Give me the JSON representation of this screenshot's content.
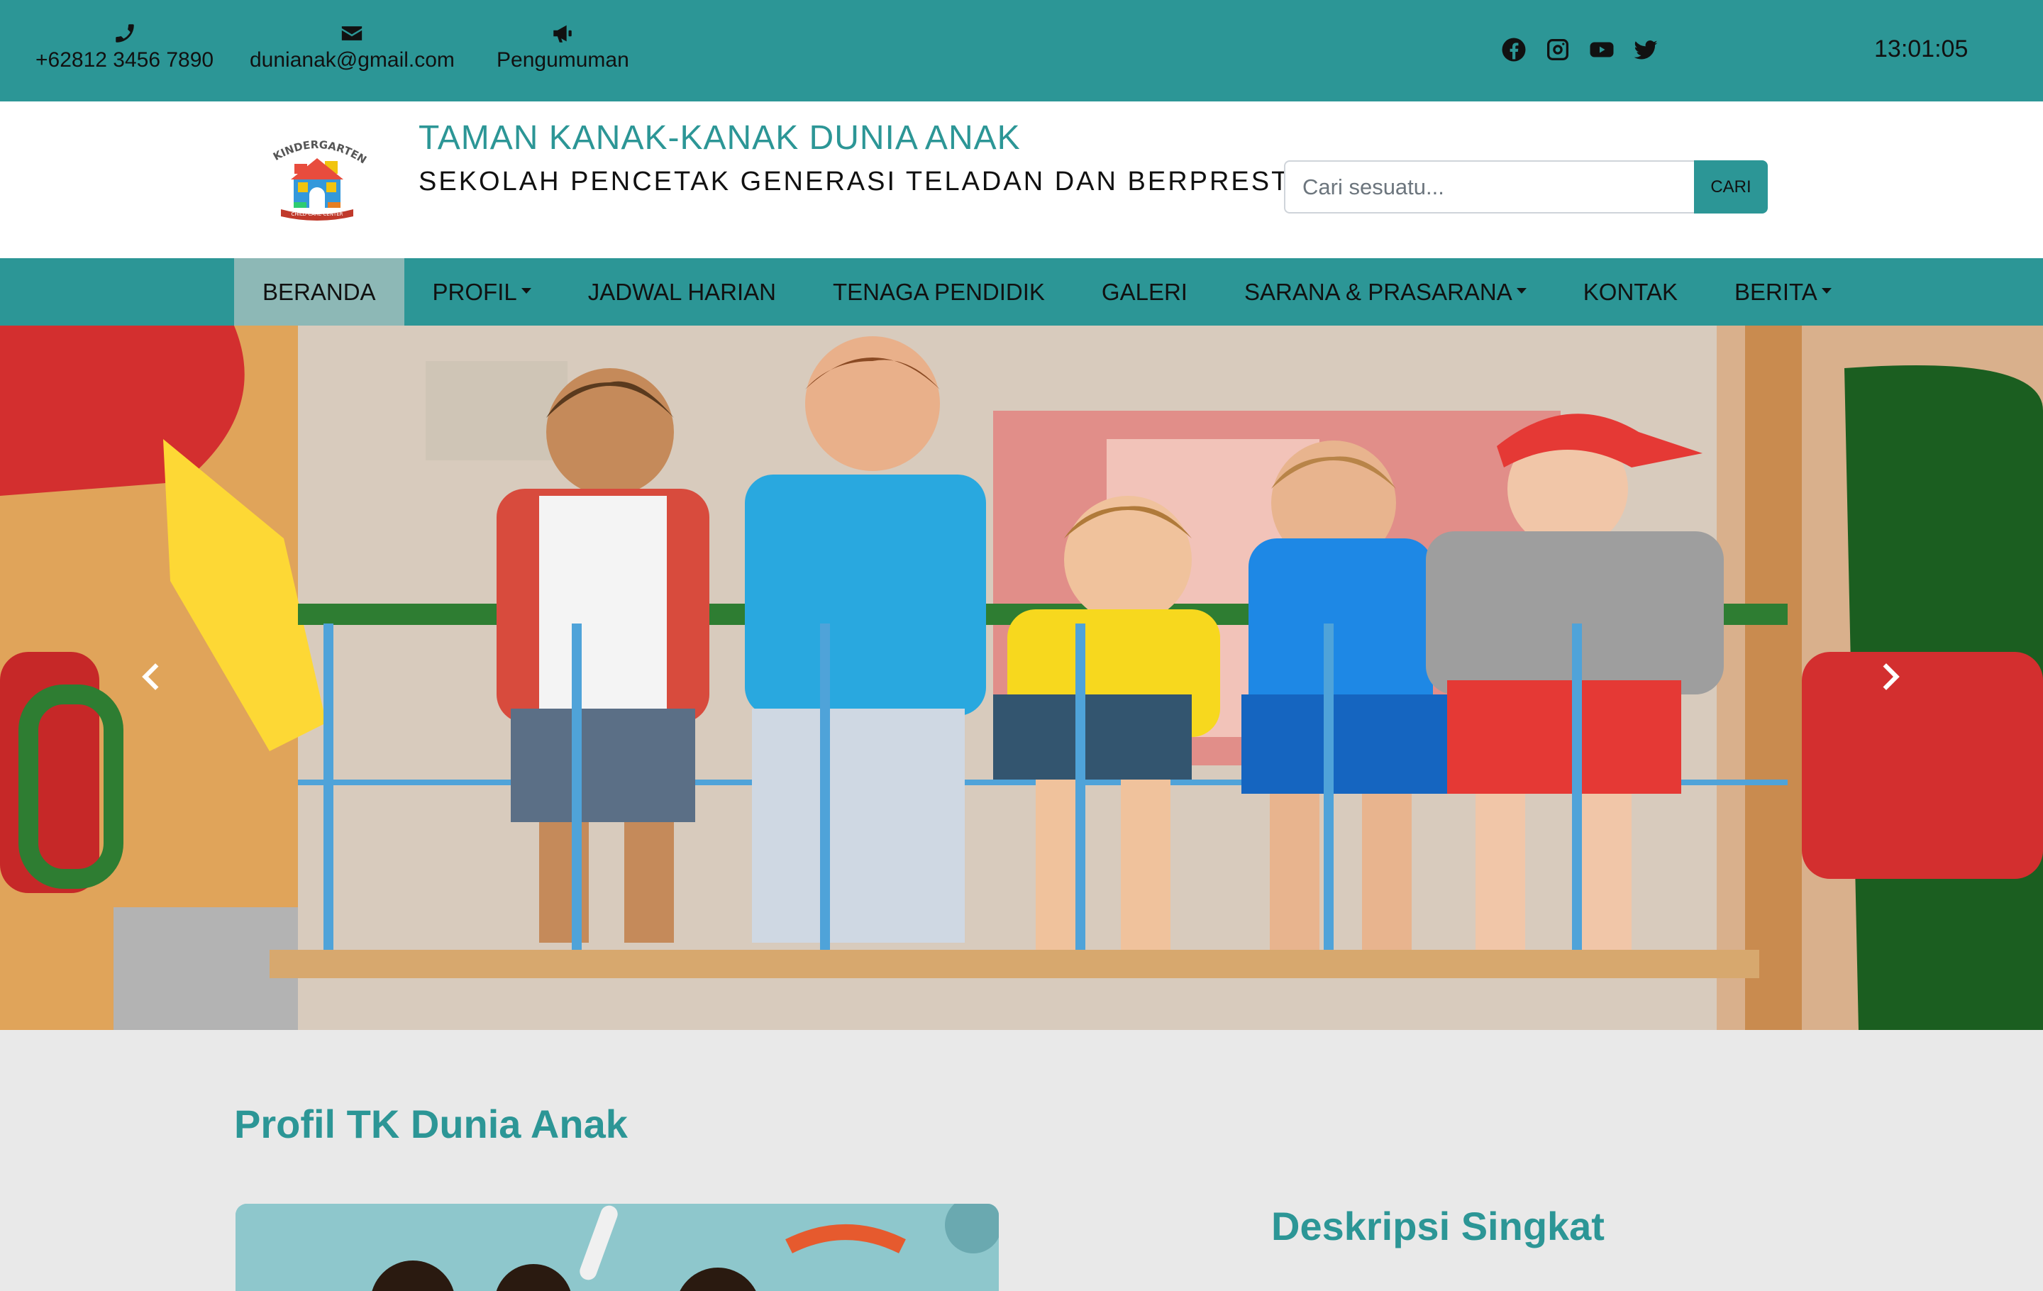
{
  "topbar": {
    "phone": "+62812 3456 7890",
    "email": "dunianak@gmail.com",
    "announcement": "Pengumuman",
    "icons": [
      "phone-icon",
      "envelope-icon",
      "megaphone-icon"
    ],
    "socials": [
      "facebook-icon",
      "instagram-icon",
      "youtube-icon",
      "twitter-icon"
    ],
    "clock": "13:01:05"
  },
  "header": {
    "logo_text": "KINDERGARTEN",
    "logo_subtext": "CHILD CARE CENTER",
    "title": "TAMAN KANAK-KANAK DUNIA ANAK",
    "tagline": "SEKOLAH PENCETAK GENERASI TELADAN DAN BERPRESTASI",
    "search_placeholder": "Cari sesuatu...",
    "search_button": "CARI"
  },
  "nav": {
    "items": [
      {
        "label": "BERANDA",
        "active": true,
        "dropdown": false
      },
      {
        "label": "PROFIL",
        "active": false,
        "dropdown": true
      },
      {
        "label": "JADWAL HARIAN",
        "active": false,
        "dropdown": false
      },
      {
        "label": "TENAGA PENDIDIK",
        "active": false,
        "dropdown": false
      },
      {
        "label": "GALERI",
        "active": false,
        "dropdown": false
      },
      {
        "label": "SARANA & PRASARANA",
        "active": false,
        "dropdown": true
      },
      {
        "label": "KONTAK",
        "active": false,
        "dropdown": false
      },
      {
        "label": "BERITA",
        "active": false,
        "dropdown": true
      }
    ]
  },
  "main": {
    "profile_title": "Profil TK Dunia Anak",
    "description_title": "Deskripsi Singkat"
  },
  "colors": {
    "accent": "#2c9696",
    "nav_active": "#8db8b6",
    "header_bg": "#ffffff",
    "page_bg": "#e9e9e9"
  }
}
